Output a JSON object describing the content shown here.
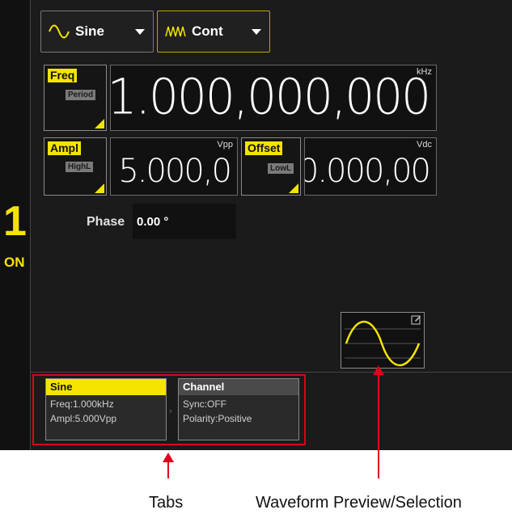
{
  "channel": {
    "number": "1",
    "state": "ON"
  },
  "toolbar": {
    "waveform": {
      "label": "Sine",
      "icon": "sine-wave-icon"
    },
    "mode": {
      "label": "Cont",
      "icon": "continuous-wave-icon"
    }
  },
  "params": {
    "freq": {
      "key": "Freq",
      "alt": "Period",
      "value": "1.000,000,000",
      "unit": "kHz"
    },
    "ampl": {
      "key": "Ampl",
      "alt": "HighL",
      "value": "5.000,0",
      "unit": "Vpp"
    },
    "offset": {
      "key": "Offset",
      "alt": "LowL",
      "value": "0.000,00",
      "unit": "Vdc"
    },
    "phase": {
      "label": "Phase",
      "value": "0.00 °"
    }
  },
  "tabs": [
    {
      "title": "Sine",
      "lines": [
        "Freq:1.000kHz",
        "Ampl:5.000Vpp"
      ],
      "active": true
    },
    {
      "title": "Channel",
      "lines": [
        "Sync:OFF",
        "Polarity:Positive"
      ],
      "active": false
    }
  ],
  "annotations": {
    "tabs": "Tabs",
    "preview": "Waveform Preview/Selection"
  },
  "colors": {
    "accent": "#f5e400",
    "background": "#1b1b1b",
    "annotation": "#e0001b"
  }
}
